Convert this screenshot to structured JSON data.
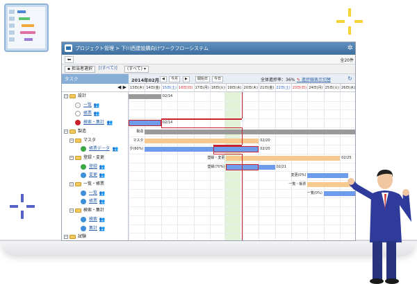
{
  "app": {
    "title": "プロジェクト管理 > 下川西建設購向けワークフローシステム",
    "total_count": "全20件",
    "back_label": "⬅"
  },
  "filter": {
    "assignee_button": "担当者選択",
    "all_paren": "[(すべて)]",
    "select_value": "(すべて)"
  },
  "header": {
    "task_column": "タスク",
    "month": "2014年02月",
    "this_month": "今月",
    "start_date": "開始日",
    "today": "今日",
    "overall_progress": "全体進捗率：36%",
    "progress_toggle": "進捗線表示切替"
  },
  "days": [
    {
      "label": "13日(木)",
      "color": "#222222"
    },
    {
      "label": "14日(金)",
      "color": "#222222"
    },
    {
      "label": "15日(土)",
      "color": "#2b5fc0"
    },
    {
      "label": "16日(日)",
      "color": "#d02a2a"
    },
    {
      "label": "17日(月)",
      "color": "#222222"
    },
    {
      "label": "18日(火)",
      "color": "#222222"
    },
    {
      "label": "19日(水)",
      "color": "#222222"
    },
    {
      "label": "20日(木)",
      "color": "#222222"
    },
    {
      "label": "21日(金)",
      "color": "#222222"
    },
    {
      "label": "22日(土)",
      "color": "#2b5fc0"
    },
    {
      "label": "23日(日)",
      "color": "#d02a2a"
    },
    {
      "label": "24日(月)",
      "color": "#222222"
    },
    {
      "label": "25日(火)",
      "color": "#222222"
    },
    {
      "label": "26日(水)",
      "color": "#222222"
    }
  ],
  "tasks": [
    {
      "name": "設計",
      "type": "folder",
      "expanded": true
    },
    {
      "name": "一覧",
      "type": "task",
      "status": "gray"
    },
    {
      "name": "帳票",
      "type": "task",
      "status": "gray"
    },
    {
      "name": "検索・集計",
      "type": "task",
      "status": "red"
    },
    {
      "name": "製造",
      "type": "folder",
      "expanded": true
    },
    {
      "name": "マスタ",
      "type": "folder",
      "expanded": true
    },
    {
      "name": "帳票データ",
      "type": "task",
      "status": "green"
    },
    {
      "name": "登録・変更",
      "type": "folder",
      "expanded": true
    },
    {
      "name": "登録",
      "type": "task",
      "status": "green"
    },
    {
      "name": "変更",
      "type": "task",
      "status": "blue"
    },
    {
      "name": "一覧・帳票",
      "type": "folder",
      "expanded": true
    },
    {
      "name": "一覧",
      "type": "task",
      "status": "blue"
    },
    {
      "name": "帳票",
      "type": "task",
      "status": "blue"
    },
    {
      "name": "検索・集計",
      "type": "folder",
      "expanded": true
    },
    {
      "name": "検索",
      "type": "task",
      "status": "blue"
    },
    {
      "name": "集計",
      "type": "task",
      "status": "blue"
    },
    {
      "name": "試験",
      "type": "folder",
      "expanded": true
    }
  ],
  "bar_labels": {
    "design_end": "02/14",
    "search_end": "02/14",
    "manufacturing_start": "製造",
    "master_start": "マスタ",
    "master_end": "02/20",
    "ledger_progress": "夕(60%)",
    "ledger_end": "02/20",
    "reg_start": "登録・変更",
    "reg_end": "02/25",
    "register_progress": "登録(70%)",
    "register_end": "02/21",
    "change_progress": "変更(0%)",
    "list_start": "一覧・帳票",
    "list_progress": "一覧(0%)"
  },
  "colors": {
    "title_bar": "#4a7cab",
    "summary_bar": "#9a9a9a",
    "orange_bar": "#f7c98e",
    "blue_bar": "#6e9bea",
    "progress_line": "#c8202c"
  }
}
